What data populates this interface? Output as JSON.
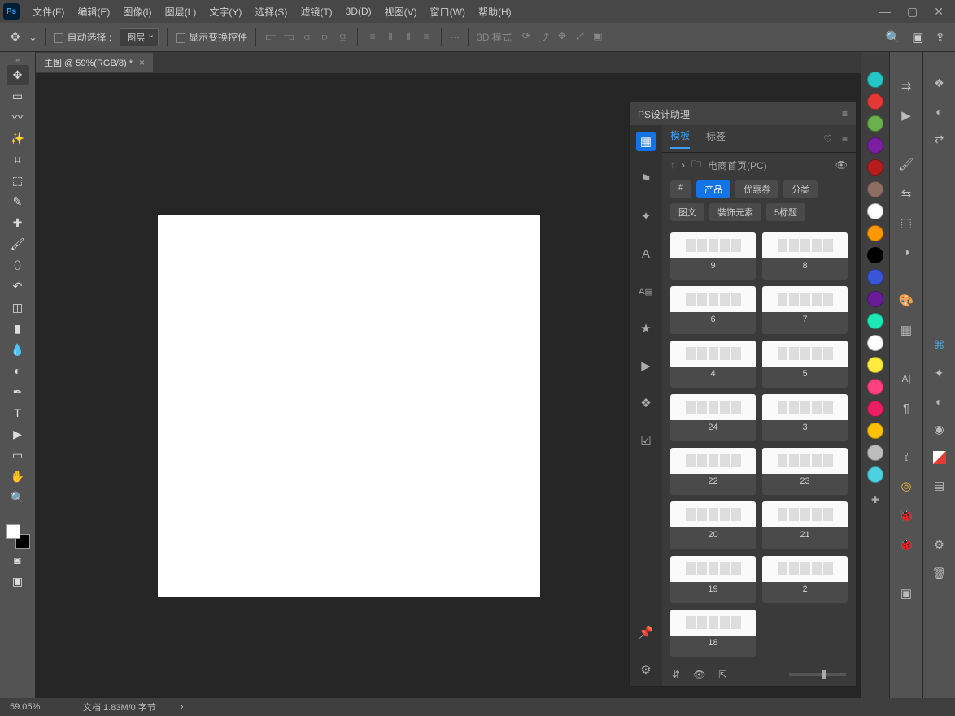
{
  "menubar": [
    "文件(F)",
    "编辑(E)",
    "图像(I)",
    "图层(L)",
    "文字(Y)",
    "选择(S)",
    "滤镜(T)",
    "3D(D)",
    "视图(V)",
    "窗口(W)",
    "帮助(H)"
  ],
  "optionsbar": {
    "autoselect": "自动选择",
    "layer_dropdown": "图层",
    "show_transform": "显示变换控件",
    "mode_3d": "3D 模式"
  },
  "doc": {
    "tab": "主图 @ 59%(RGB/8) *"
  },
  "plugin": {
    "title": "PS设计助理",
    "tabs": {
      "templates": "模板",
      "tags": "标签"
    },
    "breadcrumb": "电商首页(PC)",
    "categories": [
      "#",
      "产品",
      "优惠券",
      "分类",
      "图文",
      "装饰元素",
      "5标题"
    ],
    "active_category": "产品",
    "templates": [
      {
        "id": "9"
      },
      {
        "id": "8"
      },
      {
        "id": "6"
      },
      {
        "id": "7"
      },
      {
        "id": "4"
      },
      {
        "id": "5"
      },
      {
        "id": "24"
      },
      {
        "id": "3"
      },
      {
        "id": "22"
      },
      {
        "id": "23"
      },
      {
        "id": "20"
      },
      {
        "id": "21"
      },
      {
        "id": "19"
      },
      {
        "id": "2"
      },
      {
        "id": "18"
      }
    ]
  },
  "swatches": [
    "#24c6c6",
    "#e53935",
    "#6ab04c",
    "#7b1fa2",
    "#b71c1c",
    "#8d6e63",
    "#ffffff",
    "#ff9800",
    "#000000",
    "#3a55d6",
    "#6a1b9a",
    "#1de9b6",
    "#ffffff",
    "#ffeb3b",
    "#ff4081",
    "#e91e63",
    "#ffc107",
    "#bdbdbd",
    "#4dd0e1"
  ],
  "status": {
    "zoom": "59.05%",
    "docinfo": "文档:1.83M/0 字节"
  }
}
